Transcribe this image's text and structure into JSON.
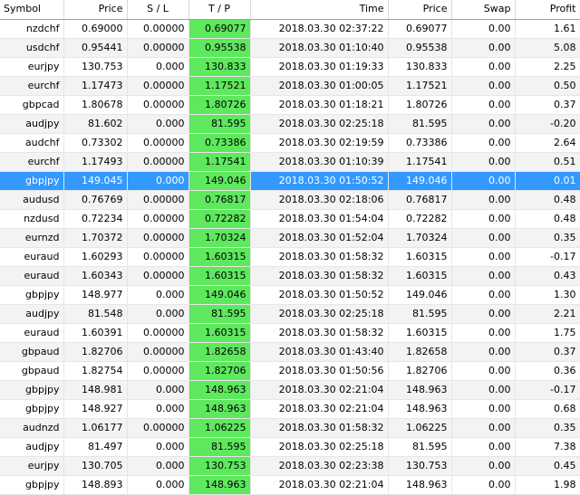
{
  "columns": [
    {
      "key": "symbol",
      "label": "Symbol",
      "align": "left"
    },
    {
      "key": "price",
      "label": "Price",
      "align": "right"
    },
    {
      "key": "sl",
      "label": "S / L",
      "align": "center"
    },
    {
      "key": "tp",
      "label": "T / P",
      "align": "center"
    },
    {
      "key": "time",
      "label": "Time",
      "align": "right"
    },
    {
      "key": "close_price",
      "label": "Price",
      "align": "right"
    },
    {
      "key": "swap",
      "label": "Swap",
      "align": "right"
    },
    {
      "key": "profit",
      "label": "Profit",
      "align": "right"
    }
  ],
  "colors": {
    "tp_highlight": "#5ee85e",
    "selected_row": "#3399ff"
  },
  "selected_index": 8,
  "rows": [
    {
      "symbol": "nzdchf",
      "price": "0.69000",
      "sl": "0.00000",
      "tp": "0.69077",
      "time": "2018.03.30 02:37:22",
      "close_price": "0.69077",
      "swap": "0.00",
      "profit": "1.61"
    },
    {
      "symbol": "usdchf",
      "price": "0.95441",
      "sl": "0.00000",
      "tp": "0.95538",
      "time": "2018.03.30 01:10:40",
      "close_price": "0.95538",
      "swap": "0.00",
      "profit": "5.08"
    },
    {
      "symbol": "eurjpy",
      "price": "130.753",
      "sl": "0.000",
      "tp": "130.833",
      "time": "2018.03.30 01:19:33",
      "close_price": "130.833",
      "swap": "0.00",
      "profit": "2.25"
    },
    {
      "symbol": "eurchf",
      "price": "1.17473",
      "sl": "0.00000",
      "tp": "1.17521",
      "time": "2018.03.30 01:00:05",
      "close_price": "1.17521",
      "swap": "0.00",
      "profit": "0.50"
    },
    {
      "symbol": "gbpcad",
      "price": "1.80678",
      "sl": "0.00000",
      "tp": "1.80726",
      "time": "2018.03.30 01:18:21",
      "close_price": "1.80726",
      "swap": "0.00",
      "profit": "0.37"
    },
    {
      "symbol": "audjpy",
      "price": "81.602",
      "sl": "0.000",
      "tp": "81.595",
      "time": "2018.03.30 02:25:18",
      "close_price": "81.595",
      "swap": "0.00",
      "profit": "-0.20"
    },
    {
      "symbol": "audchf",
      "price": "0.73302",
      "sl": "0.00000",
      "tp": "0.73386",
      "time": "2018.03.30 02:19:59",
      "close_price": "0.73386",
      "swap": "0.00",
      "profit": "2.64"
    },
    {
      "symbol": "eurchf",
      "price": "1.17493",
      "sl": "0.00000",
      "tp": "1.17541",
      "time": "2018.03.30 01:10:39",
      "close_price": "1.17541",
      "swap": "0.00",
      "profit": "0.51"
    },
    {
      "symbol": "gbpjpy",
      "price": "149.045",
      "sl": "0.000",
      "tp": "149.046",
      "time": "2018.03.30 01:50:52",
      "close_price": "149.046",
      "swap": "0.00",
      "profit": "0.01"
    },
    {
      "symbol": "audusd",
      "price": "0.76769",
      "sl": "0.00000",
      "tp": "0.76817",
      "time": "2018.03.30 02:18:06",
      "close_price": "0.76817",
      "swap": "0.00",
      "profit": "0.48"
    },
    {
      "symbol": "nzdusd",
      "price": "0.72234",
      "sl": "0.00000",
      "tp": "0.72282",
      "time": "2018.03.30 01:54:04",
      "close_price": "0.72282",
      "swap": "0.00",
      "profit": "0.48"
    },
    {
      "symbol": "eurnzd",
      "price": "1.70372",
      "sl": "0.00000",
      "tp": "1.70324",
      "time": "2018.03.30 01:52:04",
      "close_price": "1.70324",
      "swap": "0.00",
      "profit": "0.35"
    },
    {
      "symbol": "euraud",
      "price": "1.60293",
      "sl": "0.00000",
      "tp": "1.60315",
      "time": "2018.03.30 01:58:32",
      "close_price": "1.60315",
      "swap": "0.00",
      "profit": "-0.17"
    },
    {
      "symbol": "euraud",
      "price": "1.60343",
      "sl": "0.00000",
      "tp": "1.60315",
      "time": "2018.03.30 01:58:32",
      "close_price": "1.60315",
      "swap": "0.00",
      "profit": "0.43"
    },
    {
      "symbol": "gbpjpy",
      "price": "148.977",
      "sl": "0.000",
      "tp": "149.046",
      "time": "2018.03.30 01:50:52",
      "close_price": "149.046",
      "swap": "0.00",
      "profit": "1.30"
    },
    {
      "symbol": "audjpy",
      "price": "81.548",
      "sl": "0.000",
      "tp": "81.595",
      "time": "2018.03.30 02:25:18",
      "close_price": "81.595",
      "swap": "0.00",
      "profit": "2.21"
    },
    {
      "symbol": "euraud",
      "price": "1.60391",
      "sl": "0.00000",
      "tp": "1.60315",
      "time": "2018.03.30 01:58:32",
      "close_price": "1.60315",
      "swap": "0.00",
      "profit": "1.75"
    },
    {
      "symbol": "gbpaud",
      "price": "1.82706",
      "sl": "0.00000",
      "tp": "1.82658",
      "time": "2018.03.30 01:43:40",
      "close_price": "1.82658",
      "swap": "0.00",
      "profit": "0.37"
    },
    {
      "symbol": "gbpaud",
      "price": "1.82754",
      "sl": "0.00000",
      "tp": "1.82706",
      "time": "2018.03.30 01:50:56",
      "close_price": "1.82706",
      "swap": "0.00",
      "profit": "0.36"
    },
    {
      "symbol": "gbpjpy",
      "price": "148.981",
      "sl": "0.000",
      "tp": "148.963",
      "time": "2018.03.30 02:21:04",
      "close_price": "148.963",
      "swap": "0.00",
      "profit": "-0.17"
    },
    {
      "symbol": "gbpjpy",
      "price": "148.927",
      "sl": "0.000",
      "tp": "148.963",
      "time": "2018.03.30 02:21:04",
      "close_price": "148.963",
      "swap": "0.00",
      "profit": "0.68"
    },
    {
      "symbol": "audnzd",
      "price": "1.06177",
      "sl": "0.00000",
      "tp": "1.06225",
      "time": "2018.03.30 01:58:32",
      "close_price": "1.06225",
      "swap": "0.00",
      "profit": "0.35"
    },
    {
      "symbol": "audjpy",
      "price": "81.497",
      "sl": "0.000",
      "tp": "81.595",
      "time": "2018.03.30 02:25:18",
      "close_price": "81.595",
      "swap": "0.00",
      "profit": "7.38"
    },
    {
      "symbol": "eurjpy",
      "price": "130.705",
      "sl": "0.000",
      "tp": "130.753",
      "time": "2018.03.30 02:23:38",
      "close_price": "130.753",
      "swap": "0.00",
      "profit": "0.45"
    },
    {
      "symbol": "gbpjpy",
      "price": "148.893",
      "sl": "0.000",
      "tp": "148.963",
      "time": "2018.03.30 02:21:04",
      "close_price": "148.963",
      "swap": "0.00",
      "profit": "1.98"
    }
  ]
}
